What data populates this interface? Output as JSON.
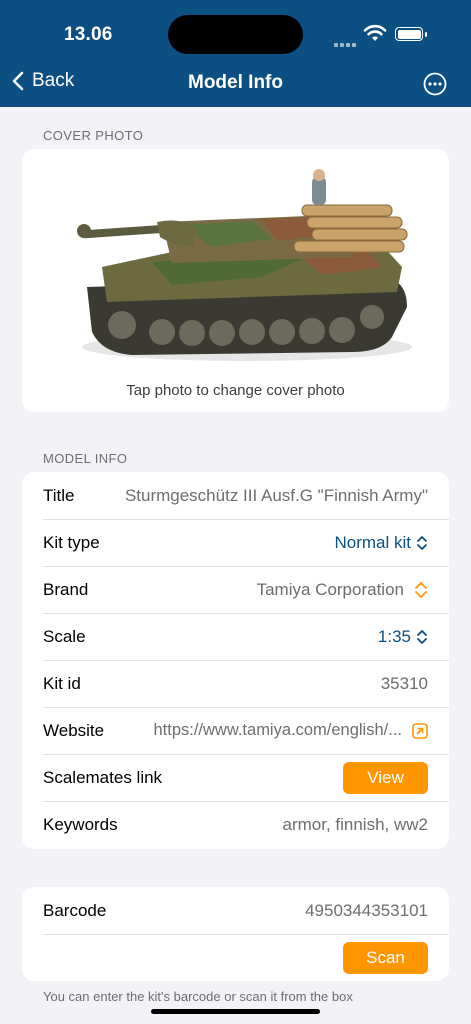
{
  "status": {
    "time": "13.06"
  },
  "nav": {
    "back_label": "Back",
    "title": "Model Info"
  },
  "cover": {
    "section_label": "COVER PHOTO",
    "hint": "Tap photo to change cover photo"
  },
  "info": {
    "section_label": "MODEL INFO",
    "title_label": "Title",
    "title_value": "Sturmgeschütz III Ausf.G \"Finnish Army\"",
    "kit_type_label": "Kit type",
    "kit_type_value": "Normal kit",
    "brand_label": "Brand",
    "brand_value": "Tamiya Corporation",
    "scale_label": "Scale",
    "scale_value": "1:35",
    "kit_id_label": "Kit id",
    "kit_id_value": "35310",
    "website_label": "Website",
    "website_value": "https://www.tamiya.com/english/...",
    "scalemates_label": "Scalemates link",
    "scalemates_button": "View",
    "keywords_label": "Keywords",
    "keywords_value": "armor, finnish, ww2"
  },
  "barcode": {
    "label": "Barcode",
    "value": "4950344353101",
    "scan_button": "Scan",
    "footnote": "You can enter the kit's barcode or scan it from the box"
  },
  "colors": {
    "nav_bg": "#0b4f83",
    "accent_orange": "#ff9500",
    "link_blue": "#0b4f83"
  }
}
